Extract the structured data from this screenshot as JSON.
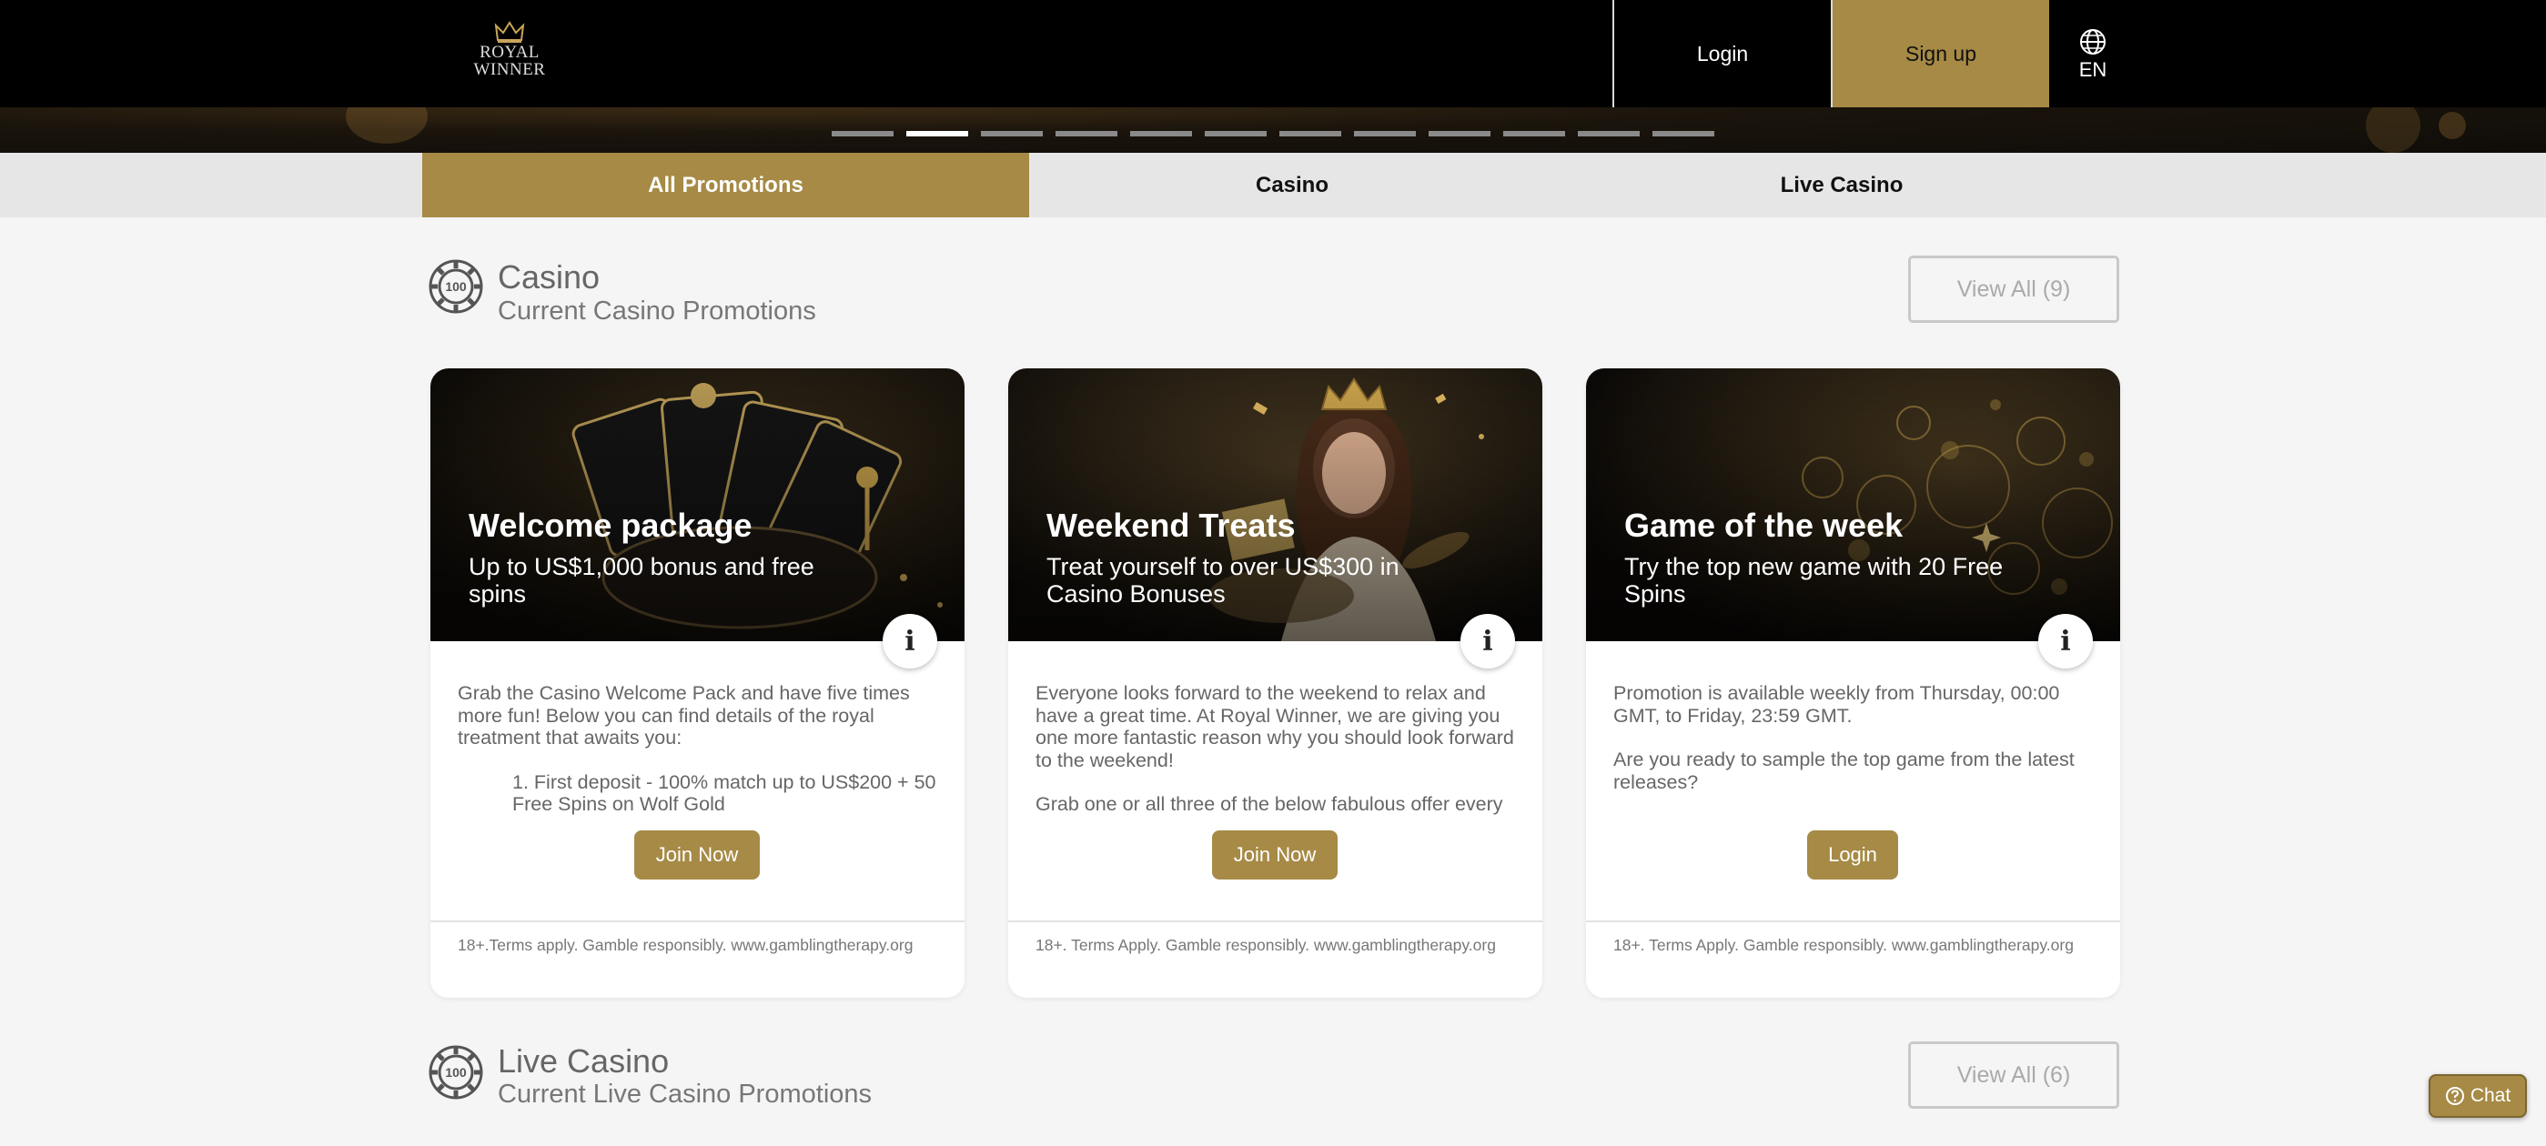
{
  "header": {
    "logo_line1": "ROYAL",
    "logo_line2": "WINNER",
    "login_label": "Login",
    "signup_label": "Sign up",
    "language_code": "EN"
  },
  "carousel": {
    "slide_count": 12,
    "active_index": 1
  },
  "tabs": [
    {
      "label": "All Promotions",
      "active": true
    },
    {
      "label": "Casino",
      "active": false
    },
    {
      "label": "Live Casino",
      "active": false
    }
  ],
  "sections": {
    "casino": {
      "icon_text": "100",
      "title": "Casino",
      "subtitle": "Current Casino Promotions",
      "view_all": "View All (9)"
    },
    "live_casino": {
      "icon_text": "100",
      "title": "Live Casino",
      "subtitle": "Current Live Casino Promotions",
      "view_all": "View All (6)"
    }
  },
  "cards": [
    {
      "title": "Welcome package",
      "subtitle": "Up to US$1,000 bonus and free spins",
      "info": "i",
      "body_p1": "Grab the Casino Welcome Pack and have five times more fun! Below you can find details of the royal treatment that awaits you:",
      "body_li1": "1. First deposit - 100% match up to US$200 + 50 Free Spins on Wolf Gold",
      "cta": "Join Now",
      "terms": "18+.Terms apply. Gamble responsibly. www.gamblingtherapy.org"
    },
    {
      "title": "Weekend Treats",
      "subtitle": "Treat yourself to over US$300 in Casino Bonuses",
      "info": "i",
      "body_p1": "Everyone looks forward to the weekend to relax and have a great time. At Royal Winner, we are giving you one more fantastic reason why you should look forward to the weekend!",
      "body_p2": "Grab one or all three of the below fabulous offer every",
      "cta": "Join Now",
      "terms": "18+. Terms Apply. Gamble responsibly. www.gamblingtherapy.org"
    },
    {
      "title": "Game of the week",
      "subtitle": "Try the top new game with 20 Free Spins",
      "info": "i",
      "body_p1": "Promotion is available weekly from Thursday, 00:00 GMT, to Friday, 23:59 GMT.",
      "body_p2": "Are you ready to sample the top game from the latest releases?",
      "cta": "Login",
      "terms": "18+. Terms Apply. Gamble responsibly. www.gamblingtherapy.org"
    }
  ],
  "chat": {
    "label": "Chat",
    "icon": "help-circle-icon"
  },
  "colors": {
    "accent": "#a68a45",
    "header_bg": "#000000",
    "page_bg": "#f5f5f5"
  }
}
